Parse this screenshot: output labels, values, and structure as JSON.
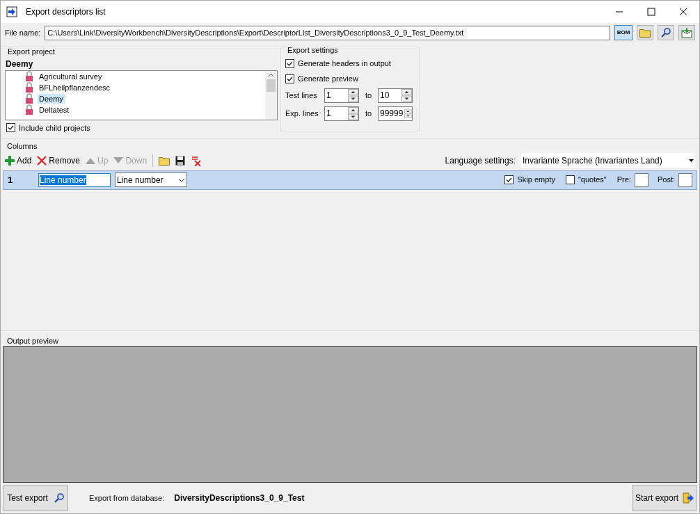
{
  "window": {
    "title": "Export descriptors list"
  },
  "file": {
    "label": "File name:",
    "value": "C:\\Users\\Link\\DiversityWorkbench\\DiversityDescriptions\\Export\\DescriptorList_DiversityDescriptions3_0_9_Test_Deemy.txt",
    "bom_label": "BOM"
  },
  "export_project": {
    "title": "Export project",
    "current": "Deemy",
    "projects": [
      {
        "name": "Agricultural survey",
        "selected": false
      },
      {
        "name": "BFLheilpflanzendesc",
        "selected": false
      },
      {
        "name": "Deemy",
        "selected": true
      },
      {
        "name": "Deltatest",
        "selected": false
      }
    ],
    "include_children": {
      "label": "Include child projects",
      "checked": true
    }
  },
  "export_settings": {
    "title": "Export settings",
    "options": [
      {
        "label": "Generate headers in output",
        "checked": true
      },
      {
        "label": "Generate preview",
        "checked": true
      }
    ],
    "ranges": [
      {
        "label": "Test lines",
        "from": "1",
        "to_label": "to",
        "to": "10"
      },
      {
        "label": "Exp. lines",
        "from": "1",
        "to_label": "to",
        "to": "99999"
      }
    ]
  },
  "columns": {
    "title": "Columns",
    "toolbar": [
      {
        "label": "Add",
        "kind": "add",
        "disabled": false
      },
      {
        "label": "Remove",
        "kind": "remove",
        "disabled": false
      },
      {
        "label": "Up",
        "kind": "up",
        "disabled": true
      },
      {
        "label": "Down",
        "kind": "down",
        "disabled": true
      }
    ],
    "language_label": "Language settings:",
    "language": "Invariante Sprache (Invariantes Land)",
    "rows": [
      {
        "index": "1",
        "name": "Line number",
        "source": "Line number",
        "selected": true,
        "skip_empty": {
          "label": "Skip empty",
          "checked": true
        },
        "quotes": {
          "label": "\"quotes\"",
          "checked": false
        },
        "pre_label": "Pre:",
        "post_label": "Post:"
      }
    ]
  },
  "output_preview": {
    "title": "Output preview"
  },
  "footer": {
    "test_button": "Test export",
    "db_label": "Export from database:",
    "db_name": "DiversityDescriptions3_0_9_Test",
    "start_button": "Start export"
  }
}
